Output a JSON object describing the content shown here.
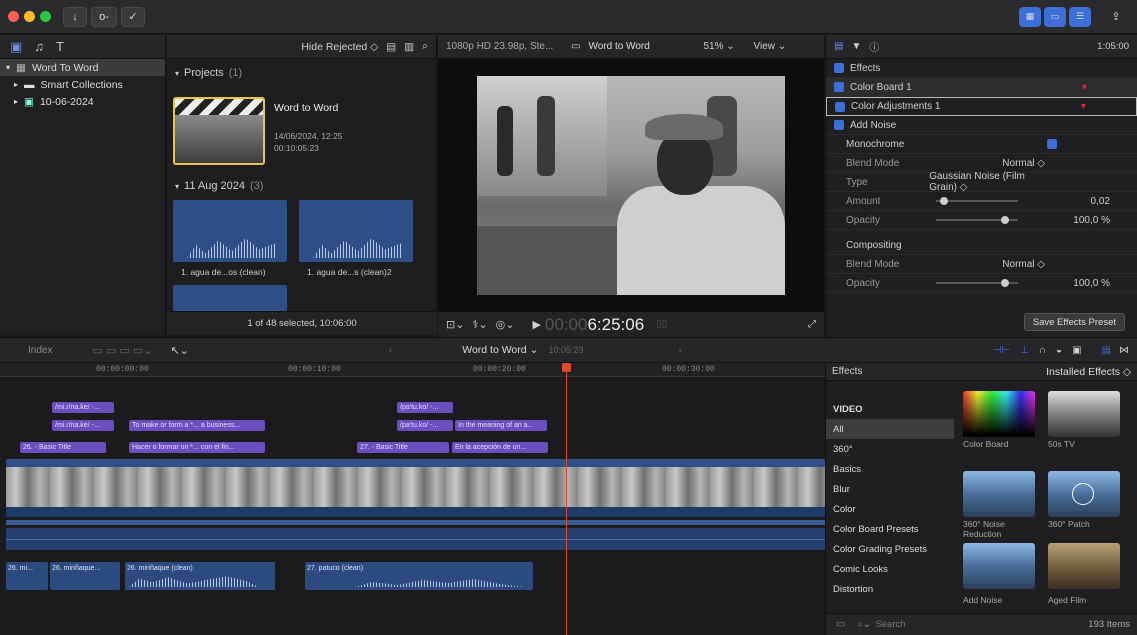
{
  "toolbar": {
    "download_icon": "↓",
    "key_icon": "o‑",
    "check_icon": "✓",
    "share_icon": "⇪"
  },
  "library": {
    "title": "Word To Word",
    "items": [
      {
        "label": "Smart Collections"
      },
      {
        "label": "10-06-2024"
      }
    ]
  },
  "browser": {
    "hide_rejected": "Hide Rejected ◇",
    "projects_label": "Projects",
    "projects_count": "(1)",
    "project_name": "Word to Word",
    "project_date": "14/06/2024, 12:25",
    "project_dur": "00:10:05:23",
    "group_label": "11 Aug 2024",
    "group_count": "(3)",
    "clips": [
      {
        "label": "1. agua de...os (clean)"
      },
      {
        "label": "1. agua de...s (clean)2"
      }
    ],
    "status": "1 of 48 selected, 10:06:00"
  },
  "viewer": {
    "format": "1080p HD 23.98p, Ste...",
    "project": "Word to Word",
    "zoom": "51% ⌄",
    "view": "View ⌄",
    "timecode_dim": "00:00",
    "timecode": "6:25:06"
  },
  "inspector": {
    "timecode": "1:05:00",
    "section": "Effects",
    "effects": [
      {
        "label": "Color Board 1"
      },
      {
        "label": "Color Adjustments 1"
      },
      {
        "label": "Add Noise"
      }
    ],
    "params": [
      {
        "label": "Monochrome",
        "value": ""
      },
      {
        "label": "Blend Mode",
        "value": "Normal ◇"
      },
      {
        "label": "Type",
        "value": "Gaussian Noise (Film Grain) ◇"
      },
      {
        "label": "Amount",
        "value": "0,02"
      },
      {
        "label": "Opacity",
        "value": "100,0 %"
      }
    ],
    "compositing": "Compositing",
    "comp_params": [
      {
        "label": "Blend Mode",
        "value": "Normal ◇"
      },
      {
        "label": "Opacity",
        "value": "100,0 %"
      }
    ],
    "save_preset": "Save Effects Preset",
    "amount_level": 0.05,
    "opacity_level": 0.88
  },
  "timeline_bar": {
    "index": "Index",
    "project": "Word to Word ⌄",
    "duration": "10:05:23"
  },
  "ruler": [
    "00:00:00:00",
    "00:00:10:00",
    "00:00:20:00",
    "00:00:30:00"
  ],
  "titles": [
    {
      "text": "/mi.ɾ/na.ke/ -...",
      "row": 0,
      "col": "a"
    },
    {
      "text": "/pa'tu.ko/ -...",
      "row": 0,
      "col": "e"
    },
    {
      "text": "/mi.ɾ/na.ke/ -...",
      "row": 1,
      "col": "a"
    },
    {
      "text": "To make or form a *... a business...",
      "row": 1,
      "col": "b"
    },
    {
      "text": "/pa'tu.ko/ -...",
      "row": 1,
      "col": "e"
    },
    {
      "text": "In the meaning of an a...",
      "row": 1,
      "col": "f"
    },
    {
      "text": "26. - Basic Title",
      "row": 2,
      "col": "c"
    },
    {
      "text": "Hacer o formar un *... con el fin...",
      "row": 2,
      "col": "d"
    },
    {
      "text": "27. - Basic Title",
      "row": 2,
      "col": "g"
    },
    {
      "text": "En la acepción de un...",
      "row": 2,
      "col": "h"
    }
  ],
  "audio_clips": [
    {
      "label": "26. mi..."
    },
    {
      "label": "26. miriñaque..."
    },
    {
      "label": "26. miriñaque (clean)"
    },
    {
      "label": "27. patuco (clean)"
    }
  ],
  "effects_browser": {
    "header": "Effects",
    "installed": "Installed Effects ◇",
    "categories": [
      "VIDEO",
      "All",
      "360°",
      "Basics",
      "Blur",
      "Color",
      "Color Board Presets",
      "Color Grading Presets",
      "Comic Looks",
      "Distortion"
    ],
    "thumbs": [
      {
        "label": "Color Board"
      },
      {
        "label": "50s TV"
      },
      {
        "label": "360° Noise Reduction"
      },
      {
        "label": "360° Patch"
      },
      {
        "label": "Add Noise"
      },
      {
        "label": "Aged Film"
      }
    ],
    "search_placeholder": "Search",
    "count": "193 Items"
  },
  "colors": {
    "accent": "#3d6fd9",
    "title_clip": "#6b4fbf",
    "video_track": "#2f4f86",
    "audio_track": "#2a4a80",
    "playhead": "#e04a2f",
    "selection": "#e8c547"
  }
}
